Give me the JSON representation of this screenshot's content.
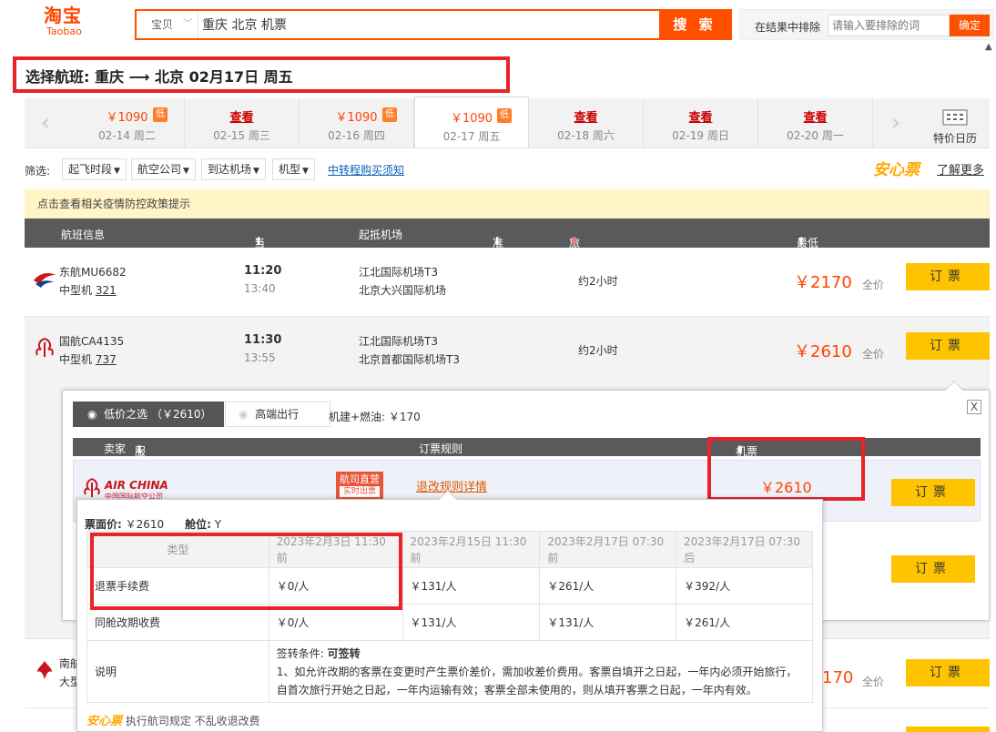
{
  "brand": {
    "cn": "淘宝",
    "en": "Taobao"
  },
  "search": {
    "category": "宝贝",
    "query": "重庆 北京 机票",
    "button": "搜 索"
  },
  "exclude": {
    "label": "在结果中排除",
    "placeholder": "请输入要排除的词",
    "button": "确定"
  },
  "selection": {
    "title": "选择航班:  重庆  ⟶  北京   02月17日 周五"
  },
  "dates": [
    {
      "price": "￥1090",
      "date": "02-14 周二",
      "low": "低"
    },
    {
      "price": "查看",
      "date": "02-15 周三"
    },
    {
      "price": "￥1090",
      "date": "02-16 周四",
      "low": "低"
    },
    {
      "price": "￥1090",
      "date": "02-17 周五",
      "low": "低"
    },
    {
      "price": "查看",
      "date": "02-18 周六"
    },
    {
      "price": "查看",
      "date": "02-19 周日"
    },
    {
      "price": "查看",
      "date": "02-20 周一"
    }
  ],
  "calendar_label": "特价日历",
  "filters": {
    "label": "筛选:",
    "items": [
      "起飞时段",
      "航空公司",
      "到达机场",
      "机型"
    ],
    "link": "中转程购买须知",
    "anxin": "安心票",
    "more": "了解更多"
  },
  "notice": "点击查看相关疫情防控政策提示",
  "columns": [
    "航班信息",
    "当地起降时间",
    "起抵机场",
    "准点率",
    "旅行总时长",
    "最低价格（不含税费）"
  ],
  "flights": [
    {
      "no": "东航MU6682",
      "plane": "中型机",
      "model": "321",
      "dep": "11:20",
      "arr": "13:40",
      "from": "江北国际机场T3",
      "to": "北京大兴国际机场",
      "duration": "约2小时",
      "price": "￥2170",
      "fare": "全价",
      "book": "订票"
    },
    {
      "no": "国航CA4135",
      "plane": "中型机",
      "model": "737",
      "dep": "11:30",
      "arr": "13:55",
      "from": "江北国际机场T3",
      "to": "北京首都国际机场T3",
      "duration": "约2小时",
      "price": "￥2610",
      "fare": "全价",
      "book": "订票"
    },
    {
      "no": "南航",
      "plane": "大型",
      "price": "170",
      "fare": "全价",
      "book": "订票"
    }
  ],
  "popup": {
    "tab_low": "低价之选 （￥2610）",
    "tab_high": "高端出行",
    "tax": "机建+燃油: ￥170",
    "head": {
      "seller": "卖家",
      "rating": "服务评分",
      "rules": "订票规则",
      "price": "机票价格（不含税费）"
    },
    "airline": "AIR CHINA",
    "airline_cn": "中国国际航空公司",
    "direct1": "航司直营",
    "direct2": "实时出票",
    "rules_link": "退改规则详情",
    "price": "￥2610",
    "book": "订票",
    "close": "X"
  },
  "tip": {
    "face_label": "票面价:",
    "face_value": "￥2610",
    "cabin_label": "舱位:",
    "cabin_value": "Y",
    "headers": [
      "类型",
      "2023年2月3日 11:30 前",
      "2023年2月15日 11:30 前",
      "2023年2月17日 07:30 前",
      "2023年2月17日 07:30 后"
    ],
    "rows": [
      [
        "退票手续费",
        "￥0/人",
        "￥131/人",
        "￥261/人",
        "￥392/人"
      ],
      [
        "同舱改期收费",
        "￥0/人",
        "￥131/人",
        "￥131/人",
        "￥261/人"
      ]
    ],
    "note_label": "说明",
    "note_title_label": "签转条件:",
    "note_title_value": "可签转",
    "note_body": "1、如允许改期的客票在变更时产生票价差价，需加收差价费用。客票自填开之日起，一年内必须开始旅行，自首次旅行开始之日起，一年内运输有效；客票全部未使用的，则从填开客票之日起，一年内有效。",
    "foot_anxin": "安心票",
    "foot_text": "执行航司规定 不乱收退改费"
  }
}
